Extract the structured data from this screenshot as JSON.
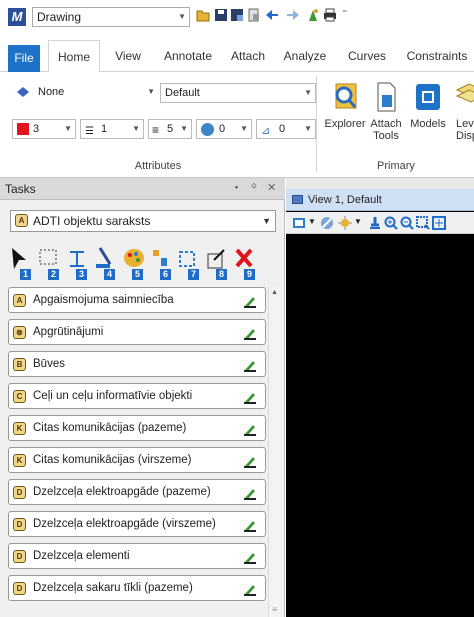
{
  "app": {
    "workflow": "Drawing"
  },
  "ribbon_tabs": [
    "File",
    "Home",
    "View",
    "Annotate",
    "Attach",
    "Analyze",
    "Curves",
    "Constraints"
  ],
  "attributes": {
    "level": "None",
    "style": "Default",
    "color_value": "3",
    "linestyle_value": "1",
    "weight_value": "5",
    "transparency_value": "0",
    "priority_value": "0",
    "group_label": "Attributes"
  },
  "primary": {
    "group_label": "Primary",
    "explorer": "Explorer",
    "attach_tools": "Attach\nTools",
    "models": "Models",
    "level_display": "Lev\nDispl"
  },
  "tasks": {
    "title": "Tasks",
    "controls": "▾ ᛜ ✕",
    "selected_task": "ADTI objektu saraksts",
    "tool_numbers": [
      "1",
      "2",
      "3",
      "4",
      "5",
      "6",
      "7",
      "8",
      "9"
    ],
    "items": [
      {
        "badge": "A",
        "label": "Apgaismojuma saimniecība"
      },
      {
        "badge": "⊗",
        "label": "Apgrūtinājumi"
      },
      {
        "badge": "B",
        "label": "Būves"
      },
      {
        "badge": "C",
        "label": "Ceļi un ceļu informatīvie objekti"
      },
      {
        "badge": "K",
        "label": "Citas komunikācijas (pazeme)"
      },
      {
        "badge": "K",
        "label": "Citas komunikācijas (virszeme)"
      },
      {
        "badge": "D",
        "label": "Dzelzceļa elektroapgāde (pazeme)"
      },
      {
        "badge": "D",
        "label": "Dzelzceļa elektroapgāde (virszeme)"
      },
      {
        "badge": "D",
        "label": "Dzelzceļa elementi"
      },
      {
        "badge": "D",
        "label": "Dzelzceļa sakaru tīkli (pazeme)"
      }
    ]
  },
  "view": {
    "title": "View 1, Default"
  },
  "colors": {
    "accent": "#1e73c8",
    "view_background": "#000000"
  }
}
